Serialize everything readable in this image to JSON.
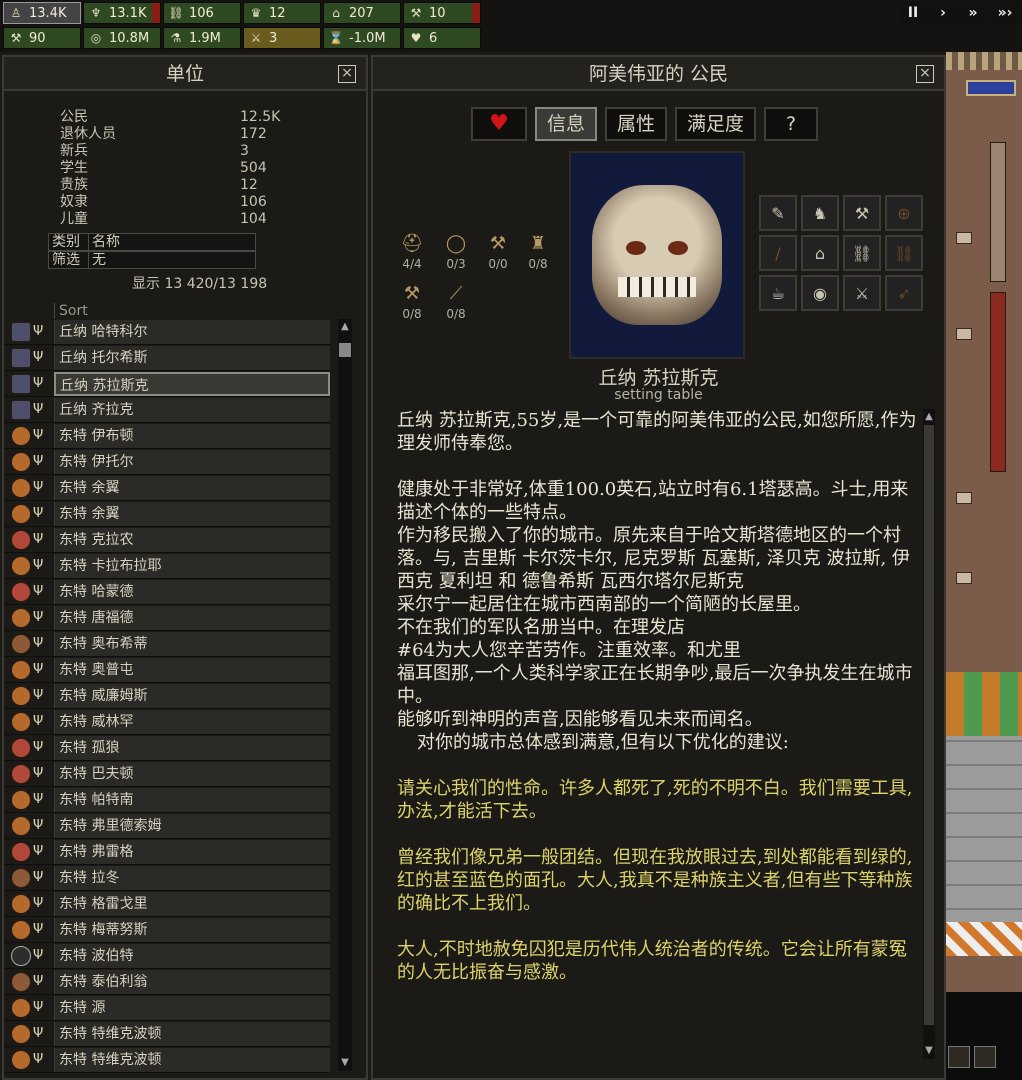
{
  "topbar": {
    "stats": [
      {
        "icon": "citizen-icon",
        "glyph": "♙",
        "value": "13.4K",
        "selected": true
      },
      {
        "icon": "food-icon",
        "glyph": "♆",
        "value": "13.1K",
        "red": true
      },
      {
        "icon": "chain-icon",
        "glyph": "⛓",
        "value": "106"
      },
      {
        "icon": "crown-icon",
        "glyph": "♛",
        "value": "12"
      },
      {
        "icon": "house-icon",
        "glyph": "⌂",
        "value": "207"
      },
      {
        "icon": "tool-icon",
        "glyph": "⚒",
        "value": "10",
        "red": true
      },
      {
        "icon": "hammer-icon",
        "glyph": "⚒",
        "value": "90"
      },
      {
        "icon": "coins-icon",
        "glyph": "◎",
        "value": "10.8M"
      },
      {
        "icon": "flask-icon",
        "glyph": "⚗",
        "value": "1.9M"
      },
      {
        "icon": "sword-icon",
        "glyph": "⚔",
        "value": "3",
        "gold": true
      },
      {
        "icon": "hourglass-icon",
        "glyph": "⌛",
        "value": "-1.0M"
      },
      {
        "icon": "heart-icon",
        "glyph": "♥",
        "value": "6"
      }
    ],
    "speed": [
      "II",
      "›",
      "»",
      "»›"
    ]
  },
  "units_panel": {
    "title": "单位",
    "close": "×",
    "counts": [
      {
        "label": "公民",
        "value": "12.5K"
      },
      {
        "label": "退休人员",
        "value": "172"
      },
      {
        "label": "新兵",
        "value": "3"
      },
      {
        "label": "学生",
        "value": "504"
      },
      {
        "label": "贵族",
        "value": "12"
      },
      {
        "label": "奴隶",
        "value": "106"
      },
      {
        "label": "儿童",
        "value": "104"
      }
    ],
    "category": {
      "label": "类别",
      "value": "名称"
    },
    "filter": {
      "label": "筛选",
      "value": "无"
    },
    "showing": "显示 13 420/13 198",
    "sort_label": "Sort",
    "units": [
      {
        "name": "丘纳 哈特科尔",
        "face": "hat"
      },
      {
        "name": "丘纳 托尔希斯",
        "face": "hat"
      },
      {
        "name": "丘纳 苏拉斯克",
        "face": "hat",
        "selected": true
      },
      {
        "name": "丘纳 齐拉克",
        "face": "hat"
      },
      {
        "name": "东特 伊布顿",
        "face": "human"
      },
      {
        "name": "东特 伊托尔",
        "face": "human"
      },
      {
        "name": "东特 余翼",
        "face": "human"
      },
      {
        "name": "东特 余翼",
        "face": "human"
      },
      {
        "name": "东特 克拉农",
        "face": "red"
      },
      {
        "name": "东特 卡拉布拉耶",
        "face": "human"
      },
      {
        "name": "东特 哈蒙德",
        "face": "red"
      },
      {
        "name": "东特 唐福德",
        "face": "human"
      },
      {
        "name": "东特 奥布希蒂",
        "face": "brown"
      },
      {
        "name": "东特 奥普屯",
        "face": "human"
      },
      {
        "name": "东特 威廉姆斯",
        "face": "human"
      },
      {
        "name": "东特 威林罕",
        "face": "human"
      },
      {
        "name": "东特 孤狼",
        "face": "red"
      },
      {
        "name": "东特 巴夫顿",
        "face": "red"
      },
      {
        "name": "东特 帕特南",
        "face": "human"
      },
      {
        "name": "东特 弗里德索姆",
        "face": "human"
      },
      {
        "name": "东特 弗雷格",
        "face": "red"
      },
      {
        "name": "东特 拉冬",
        "face": "brown"
      },
      {
        "name": "东特 格雷戈里",
        "face": "human"
      },
      {
        "name": "东特 梅蒂努斯",
        "face": "human"
      },
      {
        "name": "东特 波伯特",
        "face": "dark"
      },
      {
        "name": "东特 泰伯利翁",
        "face": "brown"
      },
      {
        "name": "东特 源",
        "face": "human"
      },
      {
        "name": "东特 特维克波顿",
        "face": "human"
      },
      {
        "name": "东特 特维克波顿",
        "face": "human"
      }
    ]
  },
  "citizen_panel": {
    "title": "阿美伟亚的 公民",
    "close": "×",
    "tabs": [
      {
        "label": "♥",
        "icon": "heart-icon"
      },
      {
        "label": "信息",
        "active": true
      },
      {
        "label": "属性"
      },
      {
        "label": "满足度"
      },
      {
        "label": "?"
      }
    ],
    "equipment": [
      {
        "icon": "helmet-icon",
        "glyph": "⛑",
        "count": "4/4"
      },
      {
        "icon": "ring-icon",
        "glyph": "◯",
        "count": "0/3"
      },
      {
        "icon": "tools-icon",
        "glyph": "⚒",
        "count": "0/0"
      },
      {
        "icon": "armor-icon",
        "glyph": "♜",
        "count": "0/8"
      },
      {
        "icon": "axe-icon",
        "glyph": "⚒",
        "count": "0/8"
      },
      {
        "icon": "bow-icon",
        "glyph": "⟋",
        "count": "0/8"
      }
    ],
    "skills": [
      {
        "icon": "brush-icon",
        "glyph": "✎"
      },
      {
        "icon": "shield-icon",
        "glyph": "♞"
      },
      {
        "icon": "hammer-icon",
        "glyph": "⚒"
      },
      {
        "icon": "target-icon",
        "glyph": "⊕",
        "dim": true
      },
      {
        "icon": "sword-icon",
        "glyph": "/",
        "dim": true
      },
      {
        "icon": "roof-icon",
        "glyph": "⌂"
      },
      {
        "icon": "chain-icon",
        "glyph": "⛓"
      },
      {
        "icon": "rope-icon",
        "glyph": "⛓",
        "dim": true
      },
      {
        "icon": "mug-icon",
        "glyph": "☕"
      },
      {
        "icon": "coin-stack-icon",
        "glyph": "◉"
      },
      {
        "icon": "no-hammer-icon",
        "glyph": "⚔"
      },
      {
        "icon": "crossbow-icon",
        "glyph": "➶",
        "dim": true
      }
    ],
    "name": "丘纳 苏拉斯克",
    "job": "setting table",
    "bio": [
      {
        "text": "丘纳 苏拉斯克,55岁,是一个可靠的阿美伟亚的公民,如您所愿,作为理发师侍奉您。",
        "style": "normal"
      },
      {
        "text": "健康处于非常好,体重100.0英石,站立时有6.1塔瑟高。斗士,用来描述个体的一些特点。",
        "style": "plain"
      },
      {
        "text": "作为移民搬入了你的城市。原先来自于哈文斯塔德地区的一个村落。与, 吉里斯 卡尔茨卡尔, 尼克罗斯 瓦塞斯, 泽贝克 波拉斯, 伊西克 夏利坦 和 德鲁希斯 瓦西尔塔尔尼斯克",
        "style": "plain"
      },
      {
        "text": "采尔宁一起居住在城市西南部的一个简陋的长屋里。",
        "style": "plain"
      },
      {
        "text": "不在我们的军队名册当中。在理发店",
        "style": "plain"
      },
      {
        "text": "#64为大人您辛苦劳作。注重效率。和尤里",
        "style": "plain"
      },
      {
        "text": "福耳图那,一个人类科学家正在长期争吵,最后一次争执发生在城市中。",
        "style": "plain"
      },
      {
        "text": "能够听到神明的声音,因能够看见未来而闻名。",
        "style": "plain"
      },
      {
        "text": "对你的城市总体感到满意,但有以下优化的建议:",
        "style": "indent"
      },
      {
        "text": "请关心我们的性命。许多人都死了,死的不明不白。我们需要工具,办法,才能活下去。",
        "style": "quote"
      },
      {
        "text": "曾经我们像兄弟一般团结。但现在我放眼过去,到处都能看到绿的,红的甚至蓝色的面孔。大人,我真不是种族主义者,但有些下等种族的确比不上我们。",
        "style": "quote"
      },
      {
        "text": "大人,不时地赦免囚犯是历代伟人统治者的传统。它会让所有蒙冤的人无比振奋与感激。",
        "style": "quote"
      }
    ]
  }
}
